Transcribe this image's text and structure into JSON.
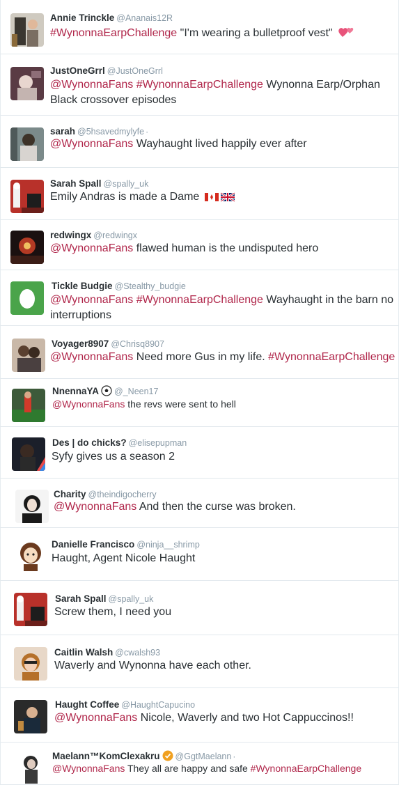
{
  "accent_color": "#b0264a",
  "tweets": [
    {
      "name": "Annie Trinckle",
      "handle": "@Ananais12R",
      "parts": [
        {
          "t": "#WynonnaEarpChallenge",
          "link": true
        },
        {
          "t": " \"I'm wearing a bulletproof vest\" ",
          "link": false
        }
      ],
      "emoji": "two-hearts-icon"
    },
    {
      "name": "JustOneGrrl",
      "handle": "@JustOneGrrl",
      "parts": [
        {
          "t": "@WynonnaFans",
          "link": true
        },
        {
          "t": " ",
          "link": false
        },
        {
          "t": "#WynonnaEarpChallenge",
          "link": true
        },
        {
          "t": " Wynonna Earp/Orphan Black crossover episodes",
          "link": false
        }
      ]
    },
    {
      "name": "sarah",
      "handle": "@5hsavedmylyfe",
      "dot": "·",
      "parts": [
        {
          "t": "@WynonnaFans",
          "link": true
        },
        {
          "t": " Wayhaught lived happily ever after",
          "link": false
        }
      ]
    },
    {
      "name": "Sarah Spall",
      "handle": "@spally_uk",
      "parts": [
        {
          "t": "Emily Andras is made a Dame ",
          "link": false
        }
      ],
      "emoji": "canada-uk-flags-icon"
    },
    {
      "name": "redwingx",
      "handle": "@redwingx",
      "parts": [
        {
          "t": "@WynonnaFans",
          "link": true
        },
        {
          "t": " flawed human is the undisputed hero",
          "link": false
        }
      ]
    },
    {
      "name": "Tickle Budgie",
      "handle": "@Stealthy_budgie",
      "parts": [
        {
          "t": "@WynonnaFans",
          "link": true
        },
        {
          "t": " ",
          "link": false
        },
        {
          "t": "#WynonnaEarpChallenge",
          "link": true
        },
        {
          "t": " Wayhaught in the barn no interruptions",
          "link": false
        }
      ]
    },
    {
      "name": "Voyager8907",
      "handle": "@Chrisq8907",
      "parts": [
        {
          "t": "@WynonnaFans",
          "link": true
        },
        {
          "t": " Need more Gus in my life. ",
          "link": false
        },
        {
          "t": "#WynonnaEarpChallenge",
          "link": true
        }
      ]
    },
    {
      "name": "NnennaYA",
      "handle": "@_Neen17",
      "name_emoji": "soccer-ball-icon",
      "small": true,
      "parts": [
        {
          "t": "@WynonnaFans",
          "link": true
        },
        {
          "t": " the revs were sent to hell",
          "link": false
        }
      ]
    },
    {
      "name": "Des | do chicks?",
      "handle": "@elisepupman",
      "parts": [
        {
          "t": "Syfy gives us a season 2",
          "link": false
        }
      ]
    },
    {
      "name": "Charity",
      "handle": "@theindigocherry",
      "parts": [
        {
          "t": "@WynonnaFans",
          "link": true
        },
        {
          "t": " And then the curse was broken.",
          "link": false
        }
      ]
    },
    {
      "name": "Danielle Francisco",
      "handle": "@ninja__shrimp",
      "parts": [
        {
          "t": "Haught, Agent Nicole Haught",
          "link": false
        }
      ]
    },
    {
      "name": "Sarah Spall",
      "handle": "@spally_uk",
      "parts": [
        {
          "t": "Screw them, I need you",
          "link": false
        }
      ]
    },
    {
      "name": "Caitlin Walsh",
      "handle": "@cwalsh93",
      "parts": [
        {
          "t": "Waverly and Wynonna have each other.",
          "link": false
        }
      ]
    },
    {
      "name": "Haught Coffee",
      "handle": "@HaughtCapucino",
      "parts": [
        {
          "t": "@WynonnaFans",
          "link": true
        },
        {
          "t": " Nicole, Waverly and two Hot Cappuccinos!!",
          "link": false
        }
      ]
    },
    {
      "name": "Maelann™KomClexakru",
      "handle": "@GgtMaelann",
      "dot": "·",
      "name_emoji": "verified-badge-icon",
      "small": true,
      "parts": [
        {
          "t": "@WynonnaFans",
          "link": true
        },
        {
          "t": " They all are happy and safe ",
          "link": false
        },
        {
          "t": "#WynonnaEarpChallenge",
          "link": true
        }
      ]
    }
  ]
}
